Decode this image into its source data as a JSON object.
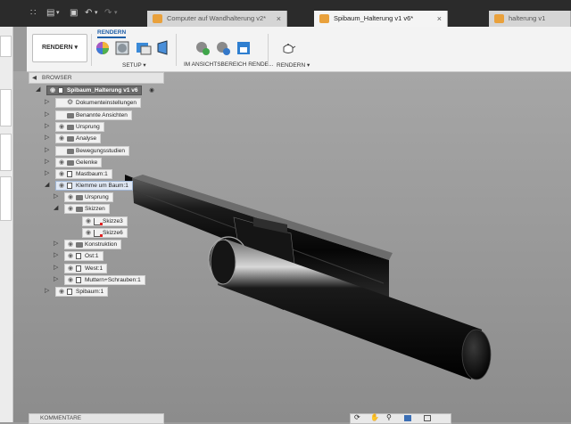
{
  "tabs": [
    {
      "label": "Computer auf Wandhalterung v2*",
      "active": false
    },
    {
      "label": "Spibaum_Halterung v1 v6*",
      "active": true
    },
    {
      "label": "halterung v1",
      "active": false
    }
  ],
  "quick_access": {
    "grid": "∷",
    "file": "▤",
    "save": "▣",
    "undo": "↶",
    "redo": "↷",
    "caret": "▾"
  },
  "toolbar": {
    "mode_button": "RENDERN ▾",
    "active_tab": "RENDERN",
    "groups": [
      {
        "label": "SETUP ▾"
      },
      {
        "label": "IM ANSICHTSBEREICH RENDE..."
      },
      {
        "label": "RENDERN ▾"
      }
    ]
  },
  "browser": {
    "title": "BROWSER",
    "root": "Spibaum_Halterung v1 v6",
    "nodes": [
      {
        "label": "Dokumenteinstellungen",
        "icon": "gear-icon"
      },
      {
        "label": "Benannte Ansichten",
        "icon": "folder-icon"
      },
      {
        "label": "Ursprung",
        "icon": "folder-icon"
      },
      {
        "label": "Analyse",
        "icon": "folder-icon"
      },
      {
        "label": "Bewegungsstudien",
        "icon": "folder-icon"
      },
      {
        "label": "Gelenke",
        "icon": "folder-icon"
      },
      {
        "label": "Mastbaum:1",
        "icon": "component-icon"
      },
      {
        "label": "Klemme um Baum:1",
        "icon": "component-icon"
      },
      {
        "label": "Ursprung",
        "icon": "folder-icon"
      },
      {
        "label": "Skizzen",
        "icon": "folder-icon"
      },
      {
        "label": "Skizze3",
        "icon": "sketch-icon"
      },
      {
        "label": "Skizze6",
        "icon": "sketch-icon"
      },
      {
        "label": "Konstruktion",
        "icon": "folder-icon"
      },
      {
        "label": "Ost:1",
        "icon": "component-icon"
      },
      {
        "label": "West:1",
        "icon": "component-icon"
      },
      {
        "label": "Muttern+Schrauben:1",
        "icon": "component-icon"
      },
      {
        "label": "Spibaum:1",
        "icon": "component-icon"
      }
    ]
  },
  "comments": {
    "title": "KOMMENTARE"
  },
  "glyphs": {
    "eye": "◉",
    "collapsed": "▷",
    "expanded": "◢",
    "radio": "◉",
    "gear": "⚙",
    "close": "×",
    "handle": "≡"
  }
}
